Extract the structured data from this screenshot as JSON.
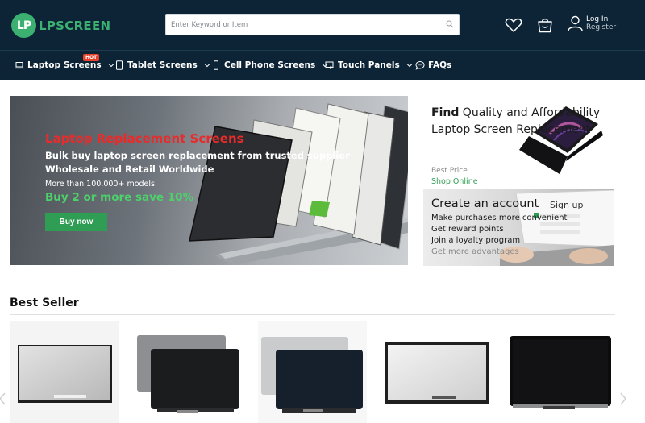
{
  "header": {
    "logo_mark": "LP",
    "logo_text": "LPSCREEN",
    "search_placeholder": "Enter Keyword or Item",
    "login_label": "Log In",
    "register_label": "Register"
  },
  "nav": {
    "hot_badge": "HOT",
    "items": [
      {
        "label": "Laptop Screens",
        "icon": "laptop-icon"
      },
      {
        "label": "Tablet Screens",
        "icon": "tablet-icon"
      },
      {
        "label": "Cell Phone Screens",
        "icon": "phone-icon"
      },
      {
        "label": "Touch Panels",
        "icon": "touch-panel-icon"
      },
      {
        "label": "FAQs",
        "icon": "chat-icon"
      }
    ]
  },
  "hero": {
    "title": "Laptop Replacement Screens",
    "subtitle_1": "Bulk buy laptop screen replacement from trusted supplier",
    "subtitle_2": "Wholesale and Retail Worldwide",
    "models": "More than 100,000+ models",
    "promo": "Buy 2 or more save 10%",
    "button": "Buy now"
  },
  "promo_quality": {
    "title_bold": "Find",
    "title_rest": " Quality and Affordability Laptop Screen Replacement",
    "price_label": "Best Price",
    "shop_label": "Shop Online"
  },
  "promo_account": {
    "title": "Create an account",
    "line_1": "Make purchases more convenient",
    "line_2": "Get reward points",
    "line_3": "Join a loyalty program",
    "line_4": "Get more advantages",
    "screen_text": "Sign up"
  },
  "best_seller": {
    "title": "Best Seller"
  },
  "colors": {
    "header_bg": "#0d2436",
    "brand_green": "#3bb071",
    "hero_red": "#e82b2b",
    "promo_green": "#4cd26a",
    "button_green": "#2f9d53",
    "hot_red": "#e8412c"
  }
}
